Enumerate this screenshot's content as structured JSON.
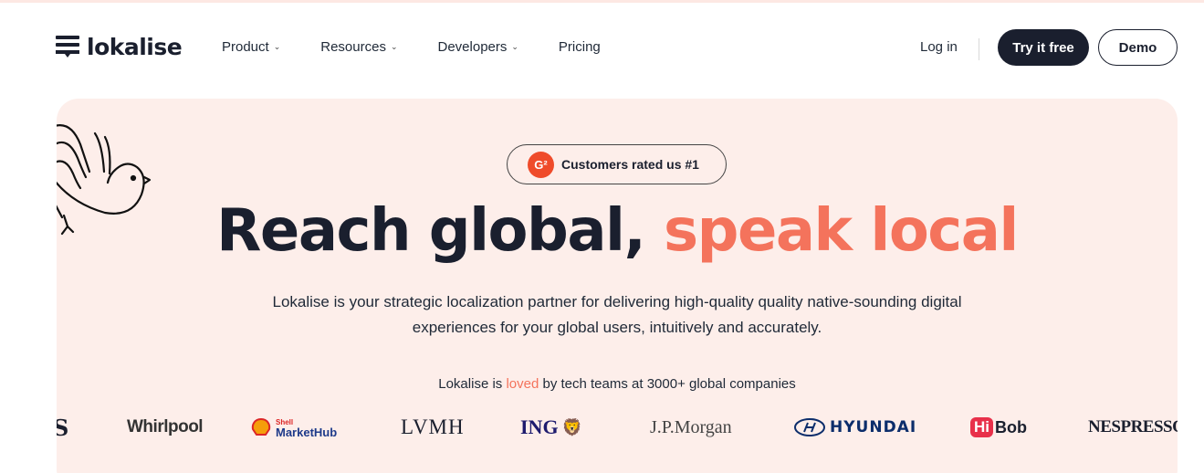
{
  "brand": {
    "name": "lokalise"
  },
  "nav": {
    "items": [
      {
        "label": "Product",
        "has_dropdown": true
      },
      {
        "label": "Resources",
        "has_dropdown": true
      },
      {
        "label": "Developers",
        "has_dropdown": true
      },
      {
        "label": "Pricing",
        "has_dropdown": false
      }
    ],
    "login_label": "Log in",
    "try_label": "Try it free",
    "demo_label": "Demo"
  },
  "hero": {
    "badge_icon": "g2-icon",
    "badge_text": "Customers rated us #1",
    "headline_main": "Reach global, ",
    "headline_accent": "speak local",
    "subtext": "Lokalise is your strategic localization partner for delivering high-quality quality native-sounding digital experiences for your global users, intuitively and accurately.",
    "loved_prefix": "Lokalise is ",
    "loved_highlight": "loved",
    "loved_suffix": " by tech teams at 3000+ global companies"
  },
  "customer_logos": [
    {
      "name": "S"
    },
    {
      "name": "Whirlpool"
    },
    {
      "name": "Shell MarketHub",
      "line1": "Shell",
      "line2": "MarketHub"
    },
    {
      "name": "LVMH"
    },
    {
      "name": "ING"
    },
    {
      "name": "J.P.Morgan"
    },
    {
      "name": "HYUNDAI"
    },
    {
      "name": "HiBob",
      "part1": "Hi",
      "part2": "Bob"
    },
    {
      "name": "NESPRESSO"
    }
  ],
  "colors": {
    "dark": "#1a1f2e",
    "accent": "#f4735c",
    "hero_bg": "#fdeeea",
    "g2_red": "#ef4b2a"
  }
}
